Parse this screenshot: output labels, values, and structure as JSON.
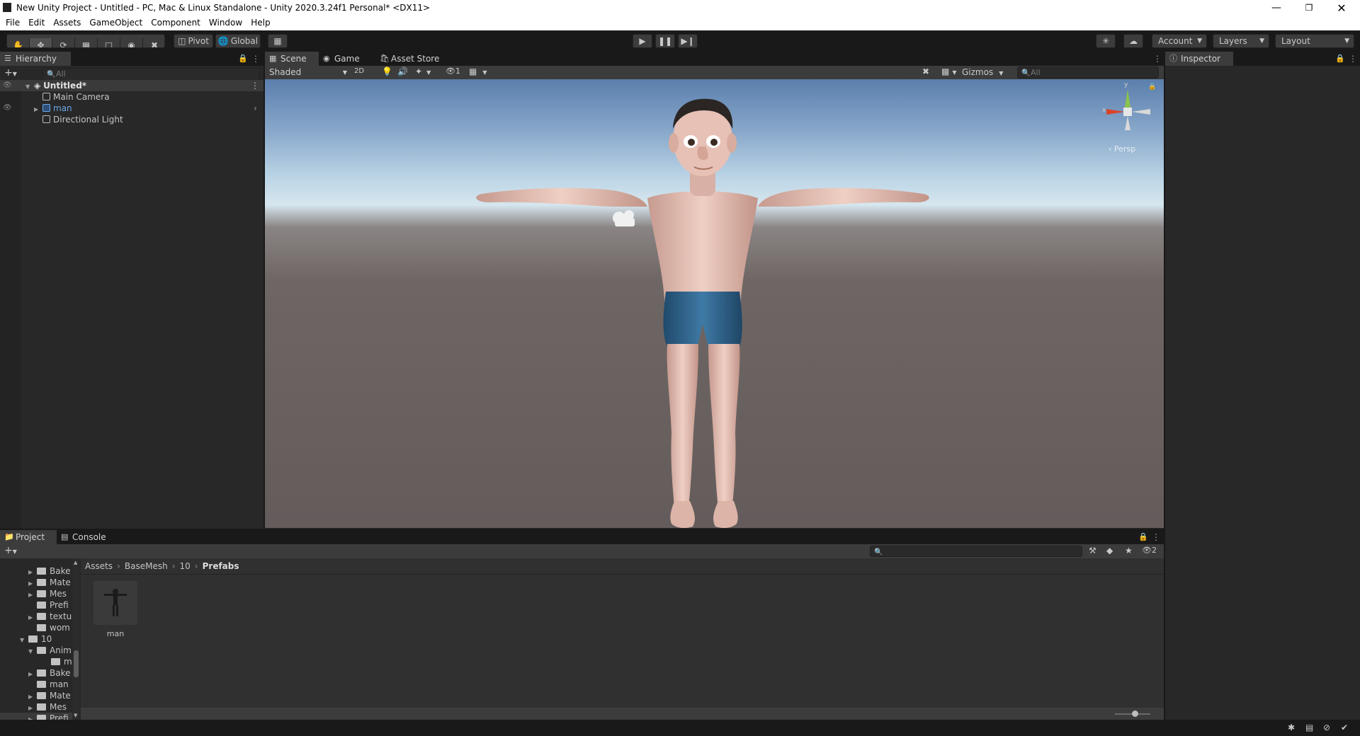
{
  "window": {
    "title": "New Unity Project - Untitled - PC, Mac & Linux Standalone - Unity 2020.3.24f1 Personal* <DX11>"
  },
  "menu": [
    "File",
    "Edit",
    "Assets",
    "GameObject",
    "Component",
    "Window",
    "Help"
  ],
  "toolbar": {
    "pivot_label": "Pivot",
    "global_label": "Global",
    "account_label": "Account",
    "layers_label": "Layers",
    "layout_label": "Layout"
  },
  "hierarchy": {
    "tab_label": "Hierarchy",
    "search_placeholder": "All",
    "scene_name": "Untitled*",
    "items": [
      "Main Camera",
      "man",
      "Directional Light"
    ]
  },
  "scene_view": {
    "tabs": [
      "Scene",
      "Game",
      "Asset Store"
    ],
    "shading_mode": "Shaded",
    "mode_2d_label": "2D",
    "hidden_count": "1",
    "gizmos_label": "Gizmos",
    "search_placeholder": "All",
    "persp_label": "‹ Persp",
    "axis_x_label": "x",
    "axis_y_label": "y"
  },
  "inspector": {
    "tab_label": "Inspector"
  },
  "project": {
    "tabs": [
      "Project",
      "Console"
    ],
    "hidden_count": "2",
    "tree": [
      {
        "label": "Bake",
        "indent": 2,
        "arrow": true
      },
      {
        "label": "Mate",
        "indent": 2,
        "arrow": true
      },
      {
        "label": "Mes",
        "indent": 2,
        "arrow": true
      },
      {
        "label": "Prefi",
        "indent": 2,
        "arrow": false
      },
      {
        "label": "textu",
        "indent": 2,
        "arrow": true
      },
      {
        "label": "wom",
        "indent": 2,
        "arrow": false
      },
      {
        "label": "10",
        "indent": 1,
        "arrow": true,
        "open": true
      },
      {
        "label": "Anim",
        "indent": 2,
        "arrow": true,
        "open": true
      },
      {
        "label": "m",
        "indent": 3,
        "arrow": false
      },
      {
        "label": "Bake",
        "indent": 2,
        "arrow": true
      },
      {
        "label": "man",
        "indent": 2,
        "arrow": false
      },
      {
        "label": "Mate",
        "indent": 2,
        "arrow": true
      },
      {
        "label": "Mes",
        "indent": 2,
        "arrow": true
      },
      {
        "label": "Prefi",
        "indent": 2,
        "arrow": true
      }
    ],
    "breadcrumb": [
      "Assets",
      "BaseMesh",
      "10",
      "Prefabs"
    ],
    "assets": [
      {
        "label": "man"
      }
    ]
  },
  "colors": {
    "accent_selected": "#4d4d4d",
    "editor_bg": "#282828",
    "toolbar_bg": "#191919",
    "hierarchy_link": "#6aa7e8"
  },
  "icons": {
    "toolbar_tools": [
      "hand-icon",
      "move-icon",
      "rotate-icon",
      "scale-icon",
      "rect-icon",
      "transform-icon",
      "custom-tool-icon"
    ],
    "playback": [
      "play-icon",
      "pause-icon",
      "step-icon"
    ]
  }
}
